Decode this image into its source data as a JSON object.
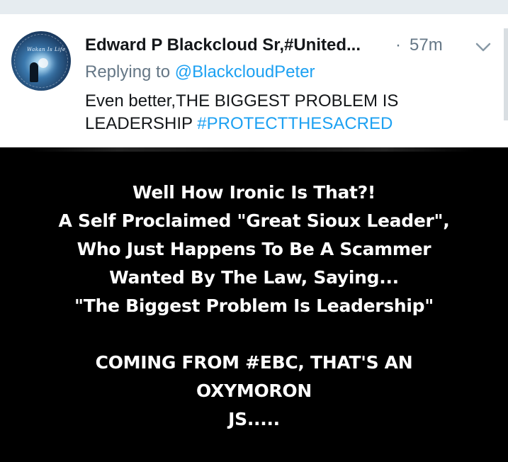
{
  "tweet": {
    "author_name": "Edward P Blackcloud Sr,#United...",
    "separator": "·",
    "timestamp": "57m",
    "reply_prefix": "Replying to ",
    "reply_handle": "@BlackcloudPeter",
    "text_line1": "Even better,THE BIGGEST PROBLEM IS",
    "text_line2_plain": "LEADERSHIP ",
    "text_hashtag": "#PROTECTTHESACRED",
    "avatar_signature": "Wakan Is Life"
  },
  "meme": {
    "lines": [
      "Well How Ironic Is That?!",
      "A Self Proclaimed \"Great Sioux Leader\",",
      "Who Just Happens To Be A Scammer",
      "Wanted By The Law, Saying...",
      "\"The Biggest Problem Is Leadership\""
    ],
    "lines2": [
      "COMING FROM #EBC, THAT'S AN",
      "OXYMORON",
      "JS....."
    ]
  },
  "colors": {
    "link": "#1da1f2",
    "secondary_text": "#657786",
    "primary_text": "#14171a",
    "meme_background": "#000000",
    "meme_text": "#ffffff"
  },
  "icons": {
    "menu": "chevron-down-icon"
  }
}
